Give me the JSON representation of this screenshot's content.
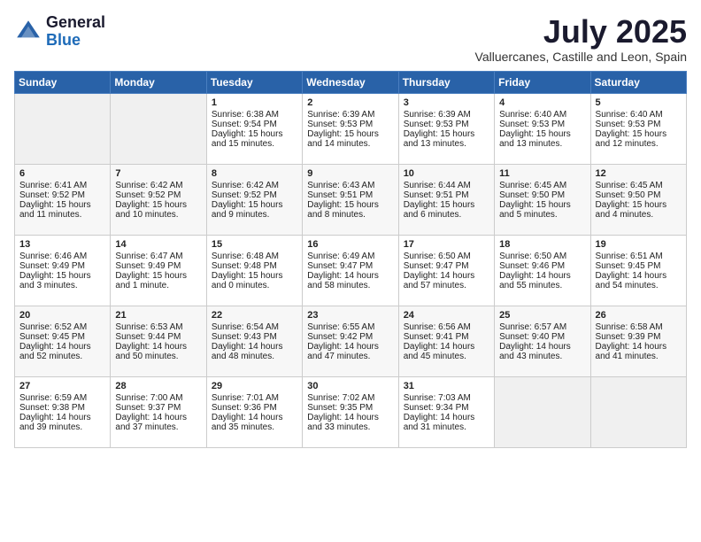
{
  "logo": {
    "general": "General",
    "blue": "Blue"
  },
  "title": "July 2025",
  "location": "Valluercanes, Castille and Leon, Spain",
  "days_of_week": [
    "Sunday",
    "Monday",
    "Tuesday",
    "Wednesday",
    "Thursday",
    "Friday",
    "Saturday"
  ],
  "weeks": [
    [
      {
        "day": "",
        "sunrise": "",
        "sunset": "",
        "daylight": "",
        "empty": true
      },
      {
        "day": "",
        "sunrise": "",
        "sunset": "",
        "daylight": "",
        "empty": true
      },
      {
        "day": "1",
        "sunrise": "Sunrise: 6:38 AM",
        "sunset": "Sunset: 9:54 PM",
        "daylight": "Daylight: 15 hours and 15 minutes."
      },
      {
        "day": "2",
        "sunrise": "Sunrise: 6:39 AM",
        "sunset": "Sunset: 9:53 PM",
        "daylight": "Daylight: 15 hours and 14 minutes."
      },
      {
        "day": "3",
        "sunrise": "Sunrise: 6:39 AM",
        "sunset": "Sunset: 9:53 PM",
        "daylight": "Daylight: 15 hours and 13 minutes."
      },
      {
        "day": "4",
        "sunrise": "Sunrise: 6:40 AM",
        "sunset": "Sunset: 9:53 PM",
        "daylight": "Daylight: 15 hours and 13 minutes."
      },
      {
        "day": "5",
        "sunrise": "Sunrise: 6:40 AM",
        "sunset": "Sunset: 9:53 PM",
        "daylight": "Daylight: 15 hours and 12 minutes."
      }
    ],
    [
      {
        "day": "6",
        "sunrise": "Sunrise: 6:41 AM",
        "sunset": "Sunset: 9:52 PM",
        "daylight": "Daylight: 15 hours and 11 minutes."
      },
      {
        "day": "7",
        "sunrise": "Sunrise: 6:42 AM",
        "sunset": "Sunset: 9:52 PM",
        "daylight": "Daylight: 15 hours and 10 minutes."
      },
      {
        "day": "8",
        "sunrise": "Sunrise: 6:42 AM",
        "sunset": "Sunset: 9:52 PM",
        "daylight": "Daylight: 15 hours and 9 minutes."
      },
      {
        "day": "9",
        "sunrise": "Sunrise: 6:43 AM",
        "sunset": "Sunset: 9:51 PM",
        "daylight": "Daylight: 15 hours and 8 minutes."
      },
      {
        "day": "10",
        "sunrise": "Sunrise: 6:44 AM",
        "sunset": "Sunset: 9:51 PM",
        "daylight": "Daylight: 15 hours and 6 minutes."
      },
      {
        "day": "11",
        "sunrise": "Sunrise: 6:45 AM",
        "sunset": "Sunset: 9:50 PM",
        "daylight": "Daylight: 15 hours and 5 minutes."
      },
      {
        "day": "12",
        "sunrise": "Sunrise: 6:45 AM",
        "sunset": "Sunset: 9:50 PM",
        "daylight": "Daylight: 15 hours and 4 minutes."
      }
    ],
    [
      {
        "day": "13",
        "sunrise": "Sunrise: 6:46 AM",
        "sunset": "Sunset: 9:49 PM",
        "daylight": "Daylight: 15 hours and 3 minutes."
      },
      {
        "day": "14",
        "sunrise": "Sunrise: 6:47 AM",
        "sunset": "Sunset: 9:49 PM",
        "daylight": "Daylight: 15 hours and 1 minute."
      },
      {
        "day": "15",
        "sunrise": "Sunrise: 6:48 AM",
        "sunset": "Sunset: 9:48 PM",
        "daylight": "Daylight: 15 hours and 0 minutes."
      },
      {
        "day": "16",
        "sunrise": "Sunrise: 6:49 AM",
        "sunset": "Sunset: 9:47 PM",
        "daylight": "Daylight: 14 hours and 58 minutes."
      },
      {
        "day": "17",
        "sunrise": "Sunrise: 6:50 AM",
        "sunset": "Sunset: 9:47 PM",
        "daylight": "Daylight: 14 hours and 57 minutes."
      },
      {
        "day": "18",
        "sunrise": "Sunrise: 6:50 AM",
        "sunset": "Sunset: 9:46 PM",
        "daylight": "Daylight: 14 hours and 55 minutes."
      },
      {
        "day": "19",
        "sunrise": "Sunrise: 6:51 AM",
        "sunset": "Sunset: 9:45 PM",
        "daylight": "Daylight: 14 hours and 54 minutes."
      }
    ],
    [
      {
        "day": "20",
        "sunrise": "Sunrise: 6:52 AM",
        "sunset": "Sunset: 9:45 PM",
        "daylight": "Daylight: 14 hours and 52 minutes."
      },
      {
        "day": "21",
        "sunrise": "Sunrise: 6:53 AM",
        "sunset": "Sunset: 9:44 PM",
        "daylight": "Daylight: 14 hours and 50 minutes."
      },
      {
        "day": "22",
        "sunrise": "Sunrise: 6:54 AM",
        "sunset": "Sunset: 9:43 PM",
        "daylight": "Daylight: 14 hours and 48 minutes."
      },
      {
        "day": "23",
        "sunrise": "Sunrise: 6:55 AM",
        "sunset": "Sunset: 9:42 PM",
        "daylight": "Daylight: 14 hours and 47 minutes."
      },
      {
        "day": "24",
        "sunrise": "Sunrise: 6:56 AM",
        "sunset": "Sunset: 9:41 PM",
        "daylight": "Daylight: 14 hours and 45 minutes."
      },
      {
        "day": "25",
        "sunrise": "Sunrise: 6:57 AM",
        "sunset": "Sunset: 9:40 PM",
        "daylight": "Daylight: 14 hours and 43 minutes."
      },
      {
        "day": "26",
        "sunrise": "Sunrise: 6:58 AM",
        "sunset": "Sunset: 9:39 PM",
        "daylight": "Daylight: 14 hours and 41 minutes."
      }
    ],
    [
      {
        "day": "27",
        "sunrise": "Sunrise: 6:59 AM",
        "sunset": "Sunset: 9:38 PM",
        "daylight": "Daylight: 14 hours and 39 minutes."
      },
      {
        "day": "28",
        "sunrise": "Sunrise: 7:00 AM",
        "sunset": "Sunset: 9:37 PM",
        "daylight": "Daylight: 14 hours and 37 minutes."
      },
      {
        "day": "29",
        "sunrise": "Sunrise: 7:01 AM",
        "sunset": "Sunset: 9:36 PM",
        "daylight": "Daylight: 14 hours and 35 minutes."
      },
      {
        "day": "30",
        "sunrise": "Sunrise: 7:02 AM",
        "sunset": "Sunset: 9:35 PM",
        "daylight": "Daylight: 14 hours and 33 minutes."
      },
      {
        "day": "31",
        "sunrise": "Sunrise: 7:03 AM",
        "sunset": "Sunset: 9:34 PM",
        "daylight": "Daylight: 14 hours and 31 minutes."
      },
      {
        "day": "",
        "sunrise": "",
        "sunset": "",
        "daylight": "",
        "empty": true
      },
      {
        "day": "",
        "sunrise": "",
        "sunset": "",
        "daylight": "",
        "empty": true
      }
    ]
  ]
}
